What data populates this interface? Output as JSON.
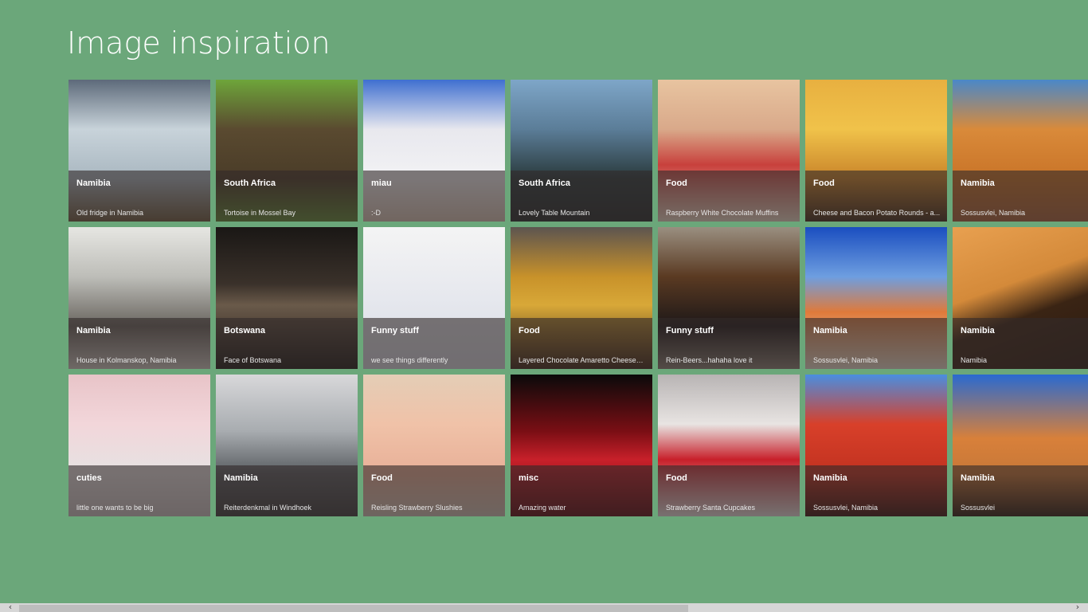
{
  "page": {
    "title": "Image inspiration"
  },
  "tiles": [
    {
      "title": "Namibia",
      "caption": "Old fridge in Namibia",
      "bg": "linear-gradient(180deg,#5d6a7a 0%,#c8d3da 35%,#a9b7c0 70%,#6b5a3c 100%)"
    },
    {
      "title": "South Africa",
      "caption": "Tortoise in Mossel Bay",
      "bg": "linear-gradient(180deg,#6ea53a 0%,#5a4a30 35%,#4a3c28 70%,#5e8a34 100%)",
      "selected": true
    },
    {
      "title": "miau",
      "caption": ":-D",
      "bg": "linear-gradient(180deg,#3f6fd0 0%,#e8e8ee 35%,#f2f2f4 70%,#d9c7b8 100%)"
    },
    {
      "title": "South Africa",
      "caption": "Lovely Table Mountain",
      "bg": "linear-gradient(180deg,#7ea6c8 0%,#5b7d98 35%,#2a3a3c 70%,#232a2a 100%)"
    },
    {
      "title": "Food",
      "caption": "Raspberry White Chocolate Muffins",
      "bg": "linear-gradient(180deg,#e8c4a0 0%,#d9a98a 35%,#c8403c 60%,#e9dcc8 100%)"
    },
    {
      "title": "Food",
      "caption": "Cheese and Bacon Potato Rounds - a...",
      "bg": "linear-gradient(180deg,#e8b040 0%,#f0c24a 35%,#c9842a 70%,#3e2a1a 100%)"
    },
    {
      "title": "Namibia",
      "caption": "Sossusvlei, Namibia",
      "bg": "linear-gradient(180deg,#4a88c8 0%,#d98a3a 35%,#c97428 70%,#a8623a 100%)"
    },
    {
      "title": "Namibia",
      "caption": "House in Kolmanskop, Namibia",
      "bg": "linear-gradient(180deg,#e6e6e2 0%,#bdbdb8 35%,#6a6660 70%,#d0cdc6 100%)"
    },
    {
      "title": "Botswana",
      "caption": "Face of Botswana",
      "bg": "linear-gradient(180deg,#1a1715 0%,#3a312a 40%,#6a5a4a 55%,#1c1916 100%)"
    },
    {
      "title": "Funny stuff",
      "caption": "we see things differently",
      "bg": "linear-gradient(180deg,#f4f4f4 0%,#e6e8ee 50%,#d8dce4 100%)"
    },
    {
      "title": "Food",
      "caption": "Layered Chocolate Amaretto Cheesecake",
      "bg": "linear-gradient(180deg,#5c5450 0%,#c8922a 35%,#d8a838 55%,#3a2418 100%)"
    },
    {
      "title": "Funny stuff",
      "caption": "Rein-Beers...hahaha love it",
      "bg": "linear-gradient(180deg,#9a8f80 0%,#5a3a22 35%,#1e1818 70%,#8a8276 100%)"
    },
    {
      "title": "Namibia",
      "caption": "Sossusvlei, Namibia",
      "bg": "linear-gradient(180deg,#1a4ec0 0%,#6e9ee0 35%,#e07a3a 60%,#e8e0d0 100%)"
    },
    {
      "title": "Namibia",
      "caption": "Namibia",
      "bg": "linear-gradient(160deg,#e8a050 0%,#d48a3a 40%,#3a2414 60%,#2a1a10 100%)"
    },
    {
      "title": "cuties",
      "caption": "little one wants to be big",
      "bg": "linear-gradient(180deg,#e8c4c8 0%,#f2d6da 35%,#e6e2e2 70%,#ccc6c6 100%)"
    },
    {
      "title": "Namibia",
      "caption": "Reiterdenkmal in Windhoek",
      "bg": "linear-gradient(180deg,#d8d8da 0%,#a8acb0 40%,#5a5e62 70%,#3a3c3c 100%)"
    },
    {
      "title": "Food",
      "caption": "Reisling Strawberry Slushies",
      "bg": "linear-gradient(180deg,#e4cdb6 0%,#f0c2a8 35%,#e8b098 70%,#cfc4b8 100%)"
    },
    {
      "title": "misc",
      "caption": "Amazing water",
      "bg": "linear-gradient(180deg,#0a0a0a 0%,#7a0e14 40%,#c8202a 60%,#5a0a10 100%)"
    },
    {
      "title": "Food",
      "caption": "Strawberry Santa Cupcakes",
      "bg": "linear-gradient(180deg,#b8b4b4 0%,#e8e4e2 35%,#c8202a 60%,#e8e4e2 100%)"
    },
    {
      "title": "Namibia",
      "caption": "Sossusvlei, Namibia",
      "bg": "linear-gradient(180deg,#4a8ee0 0%,#d8402a 35%,#c23220 70%,#3a1410 100%)"
    },
    {
      "title": "Namibia",
      "caption": "Sossusvlei",
      "bg": "linear-gradient(180deg,#2a6ad0 0%,#d8803a 45%,#c87838 70%,#2a1c12 100%)"
    }
  ],
  "scrollbar": {
    "left_arrow": "‹",
    "right_arrow": "›",
    "position": 0.0
  }
}
